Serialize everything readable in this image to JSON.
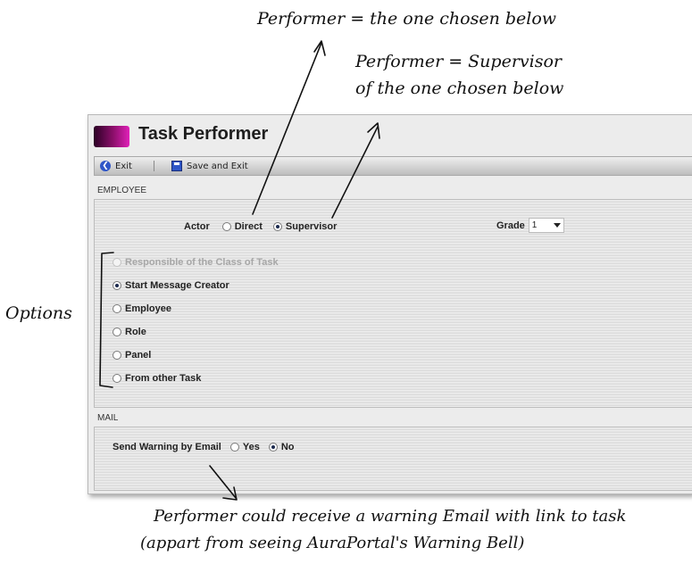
{
  "annotations": {
    "top": "Performer = the one chosen below",
    "supervisor_line1": "Performer = Supervisor",
    "supervisor_line2": "of the one chosen below",
    "options": "Options",
    "bottom_line1": "Performer could receive a warning  Email with link to task",
    "bottom_line2": "(appart from seeing AuraPortal's Warning Bell)"
  },
  "window": {
    "title": "Task Performer",
    "toolbar": {
      "exit_label": "Exit",
      "save_exit_label": "Save and Exit"
    }
  },
  "employee": {
    "section_label": "EMPLOYEE",
    "actor": {
      "label": "Actor",
      "options": [
        "Direct",
        "Supervisor"
      ],
      "selected": "Supervisor"
    },
    "grade": {
      "label": "Grade",
      "value": "1"
    },
    "options": [
      {
        "label": "Responsible of the Class of Task",
        "selected": false,
        "disabled": true
      },
      {
        "label": "Start Message Creator",
        "selected": true,
        "disabled": false
      },
      {
        "label": "Employee",
        "selected": false,
        "disabled": false
      },
      {
        "label": "Role",
        "selected": false,
        "disabled": false
      },
      {
        "label": "Panel",
        "selected": false,
        "disabled": false
      },
      {
        "label": "From other Task",
        "selected": false,
        "disabled": false
      }
    ]
  },
  "mail": {
    "section_label": "MAIL",
    "send_warning": {
      "label": "Send Warning by Email",
      "yes": "Yes",
      "no": "No",
      "selected": "No"
    }
  },
  "colors": {
    "title_icon_dark": "#2a0024",
    "title_icon_light": "#e021b8",
    "toolbar_icon": "#2f56c7"
  }
}
